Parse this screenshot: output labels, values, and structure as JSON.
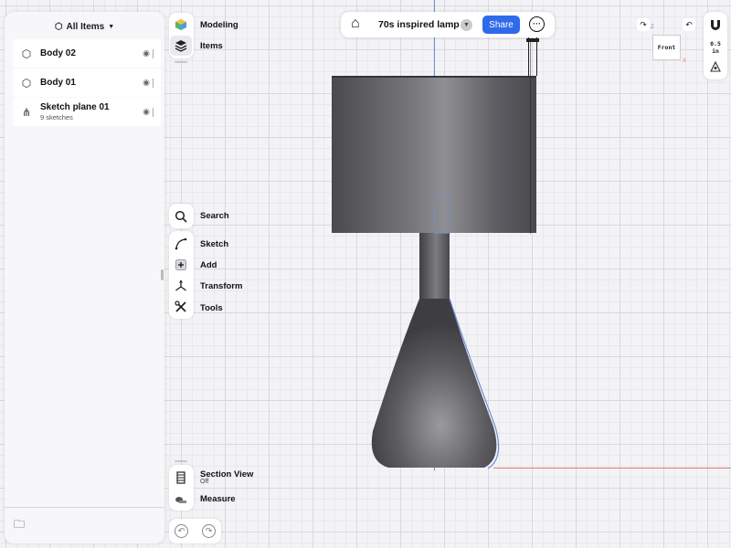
{
  "panel": {
    "header": "All Items",
    "items": [
      {
        "name": "Body 02",
        "icon": "cube-icon"
      },
      {
        "name": "Body 01",
        "icon": "cube-icon"
      },
      {
        "name": "Sketch plane 01",
        "sub": "9 sketches",
        "icon": "sketch-plane-icon"
      }
    ]
  },
  "toolbar": {
    "modeling": "Modeling",
    "items": "Items",
    "search": "Search",
    "sketch": "Sketch",
    "add": "Add",
    "transform": "Transform",
    "tools": "Tools",
    "section_view": "Section View",
    "section_view_state": "Off",
    "measure": "Measure"
  },
  "topbar": {
    "title": "70s inspired lamp",
    "share": "Share"
  },
  "viewcube": {
    "face": "Front",
    "x_label": "X",
    "z_label": "Z"
  },
  "grid": {
    "size_value": "0.5",
    "size_unit": "in"
  },
  "colors": {
    "accent": "#2f6ae9",
    "axis_x": "#e07a7a",
    "axis_z": "#6b8fd8"
  }
}
